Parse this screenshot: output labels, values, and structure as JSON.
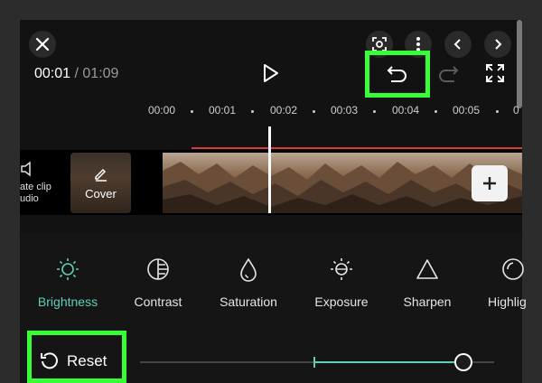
{
  "header": {
    "time_current": "00:01",
    "time_separator": "/",
    "time_total": "01:09",
    "icons": [
      "close-icon",
      "camera-scan-icon",
      "more-vert-icon",
      "chevron-left-icon",
      "chevron-right-icon",
      "play-icon",
      "undo-icon",
      "redo-icon",
      "fullscreen-icon"
    ]
  },
  "ruler": {
    "ticks": [
      "00:00",
      "00:01",
      "00:02",
      "00:03",
      "00:04",
      "00:05",
      "0"
    ]
  },
  "timeline": {
    "mute_label_line1": "ate clip",
    "mute_label_line2": "udio",
    "cover_label": "Cover",
    "add_icon": "plus-icon"
  },
  "adjustments": [
    {
      "label": "Brightness",
      "icon": "brightness-icon",
      "active": true
    },
    {
      "label": "Contrast",
      "icon": "contrast-icon",
      "active": false
    },
    {
      "label": "Saturation",
      "icon": "saturation-icon",
      "active": false
    },
    {
      "label": "Exposure",
      "icon": "exposure-icon",
      "active": false
    },
    {
      "label": "Sharpen",
      "icon": "sharpen-icon",
      "active": false
    },
    {
      "label": "Highlig",
      "icon": "highlight-icon",
      "active": false
    }
  ],
  "reset": {
    "label": "Reset"
  },
  "slider": {
    "value_fraction": 0.92,
    "center_fraction": 0.49
  },
  "colors": {
    "accent": "#5fd0b8",
    "highlight_box": "#36ff36",
    "playhead_line": "#d23c3c"
  }
}
